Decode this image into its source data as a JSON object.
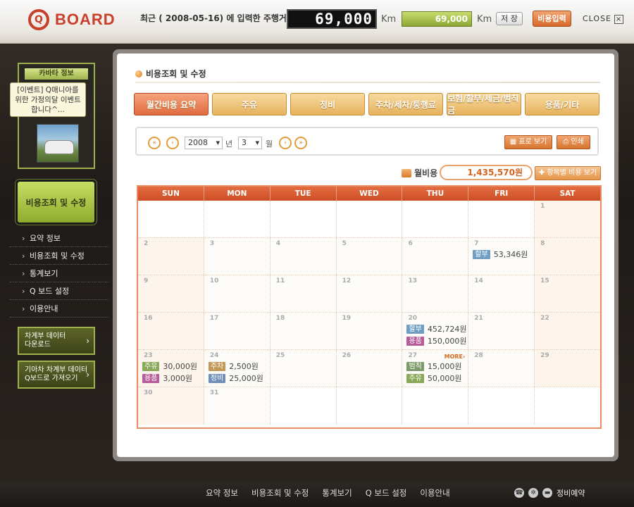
{
  "header": {
    "logo_text": "BOARD",
    "logo_letter": "Q",
    "recent_label": "최근 ( 2008-05-16) 에 입력한 주행거리 :",
    "odometer": "69,000",
    "unit": "Km",
    "mileage_input": "69,000",
    "save_label": "저 장",
    "cost_input_label": "비용입력",
    "close_label": "CLOSE",
    "close_icon": "×"
  },
  "sidebar": {
    "box_title": "카바타 정보",
    "tooltip": "[이벤트] Q매니아를 위한 가정의달 이벤트합니다^...",
    "main_label": "비용조회 및 수정",
    "nav": [
      "요약 정보",
      "비용조회 및 수정",
      "통계보기",
      "Q 보드 설정",
      "이용안내"
    ],
    "btn_download": [
      "차계부 데이터",
      "다운로드"
    ],
    "btn_import": [
      "기아차 차계부 데이터",
      "Q보드로 가져오기"
    ]
  },
  "main": {
    "breadcrumb": "비용조회 및 수정",
    "tabs": [
      "월간비용 요약",
      "주유",
      "정비",
      "주차/세차/통행료",
      "보험/할부/세금/범칙금",
      "용품/기타"
    ],
    "year": "2008",
    "year_unit": "년",
    "month": "3",
    "month_unit": "월",
    "table_view_label": "표로 보기",
    "print_label": "인쇄",
    "month_cost_label": "월비용",
    "month_cost_value": "1,435,570원",
    "by_item_label": "항목별 비용 보기"
  },
  "calendar": {
    "days_header": [
      "SUN",
      "MON",
      "TUE",
      "WED",
      "THU",
      "FRI",
      "SAT"
    ],
    "more_label": "MORE›",
    "badge_colors": {
      "할부": "#6f9ec2",
      "용품": "#b65c9b",
      "주유": "#8aa85a",
      "주차": "#c29a57",
      "정비": "#6f8fb7",
      "범칙": "#7d9a6a"
    },
    "weeks": [
      [
        null,
        null,
        null,
        null,
        null,
        null,
        {
          "d": "1"
        }
      ],
      [
        {
          "d": "2"
        },
        {
          "d": "3"
        },
        {
          "d": "4"
        },
        {
          "d": "5"
        },
        {
          "d": "6"
        },
        {
          "d": "7",
          "e": [
            [
              "할부",
              "53,346원"
            ]
          ]
        },
        {
          "d": "8"
        }
      ],
      [
        {
          "d": "9"
        },
        {
          "d": "10"
        },
        {
          "d": "11"
        },
        {
          "d": "12"
        },
        {
          "d": "13"
        },
        {
          "d": "14"
        },
        {
          "d": "15"
        }
      ],
      [
        {
          "d": "16"
        },
        {
          "d": "17"
        },
        {
          "d": "18"
        },
        {
          "d": "19"
        },
        {
          "d": "20",
          "e": [
            [
              "할부",
              "452,724원"
            ],
            [
              "용품",
              "150,000원"
            ]
          ]
        },
        {
          "d": "21"
        },
        {
          "d": "22"
        }
      ],
      [
        {
          "d": "23",
          "e": [
            [
              "주유",
              "30,000원"
            ],
            [
              "용품",
              "3,000원"
            ]
          ]
        },
        {
          "d": "24",
          "e": [
            [
              "주차",
              "2,500원"
            ],
            [
              "정비",
              "25,000원"
            ]
          ]
        },
        {
          "d": "25"
        },
        {
          "d": "26"
        },
        {
          "d": "27",
          "more": true,
          "e": [
            [
              "범칙",
              "15,000원"
            ],
            [
              "주유",
              "50,000원"
            ]
          ]
        },
        {
          "d": "28"
        },
        {
          "d": "29"
        }
      ],
      [
        {
          "d": "30"
        },
        {
          "d": "31"
        },
        null,
        null,
        null,
        null,
        null
      ]
    ]
  },
  "footer": {
    "nav": [
      "요약 정보",
      "비용조회 및 수정",
      "통계보기",
      "Q 보드 설정",
      "이용안내"
    ],
    "reserve_label": "정비예약"
  }
}
